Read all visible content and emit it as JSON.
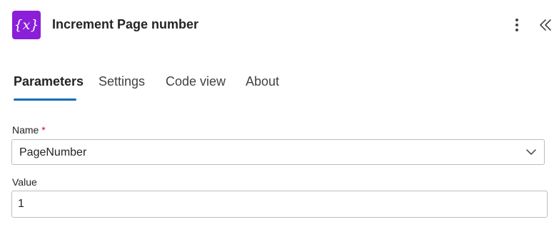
{
  "header": {
    "icon": "variable-icon",
    "icon_glyph": "{x}",
    "title": "Increment Page number"
  },
  "tabs": [
    {
      "label": "Parameters",
      "active": true
    },
    {
      "label": "Settings",
      "active": false
    },
    {
      "label": "Code view",
      "active": false
    },
    {
      "label": "About",
      "active": false
    }
  ],
  "fields": {
    "name": {
      "label": "Name",
      "required_marker": "*",
      "value": "PageNumber"
    },
    "value": {
      "label": "Value",
      "value": "1"
    }
  },
  "colors": {
    "icon_background": "#8a1fd9",
    "tab_underline": "#0f6cbd",
    "required": "#c50f1f"
  }
}
